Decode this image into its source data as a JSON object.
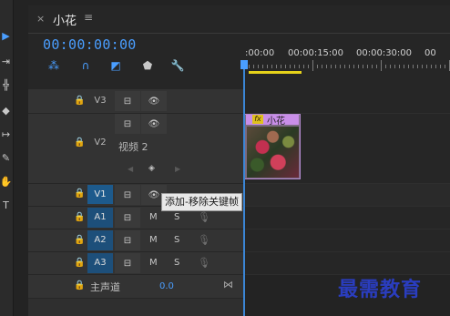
{
  "sequence": {
    "tab_title": "小花",
    "tab_menu": "≡",
    "tab_close": "×",
    "timecode": "00:00:00:00"
  },
  "ruler": {
    "labels": [
      ":00:00",
      "00:00:15:00",
      "00:00:30:00",
      "00"
    ]
  },
  "tracks": {
    "v3": {
      "name": "V3"
    },
    "v2": {
      "name": "V2",
      "label": "视频 2"
    },
    "v1": {
      "name": "V1"
    },
    "a1": {
      "name": "A1",
      "m": "M",
      "s": "S"
    },
    "a2": {
      "name": "A2",
      "m": "M",
      "s": "S"
    },
    "a3": {
      "name": "A3",
      "m": "M",
      "s": "S"
    },
    "master": {
      "name": "主声道",
      "value": "0.0"
    }
  },
  "clip": {
    "fx": "fx",
    "name": "小花"
  },
  "tooltip": "添加-移除关键帧",
  "watermark": "最需教育",
  "colors": {
    "accent": "#4a9eff",
    "selected_track": "#1d5a8c",
    "clip": "#c98ee8",
    "work_area": "#e6d21a"
  }
}
